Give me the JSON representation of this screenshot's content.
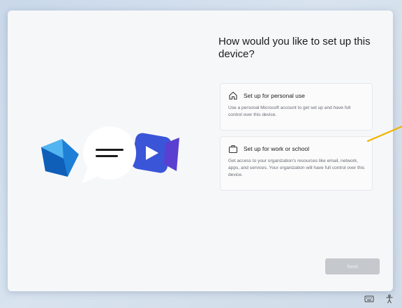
{
  "oobe": {
    "title": "How would you like to set up this device?",
    "options": [
      {
        "icon": "home-icon",
        "label": "Set up for personal use",
        "description": "Use a personal Microsoft account to get set up and have full control over this device."
      },
      {
        "icon": "briefcase-icon",
        "label": "Set up for work or school",
        "description": "Get access to your organization's resources like email, network, apps, and services. Your organization will have full control over this device."
      }
    ],
    "next_label": "Next",
    "next_enabled": false
  },
  "illustration": {
    "icons": [
      "mail-icon",
      "chat-bubble-icon",
      "video-camera-icon"
    ]
  },
  "taskbar": {
    "icons": [
      "keyboard-icon",
      "accessibility-icon"
    ]
  },
  "colors": {
    "accent_annotation": "#f0b400",
    "mail_blue": "#1e7fd6",
    "video_blue": "#3a55d8"
  }
}
